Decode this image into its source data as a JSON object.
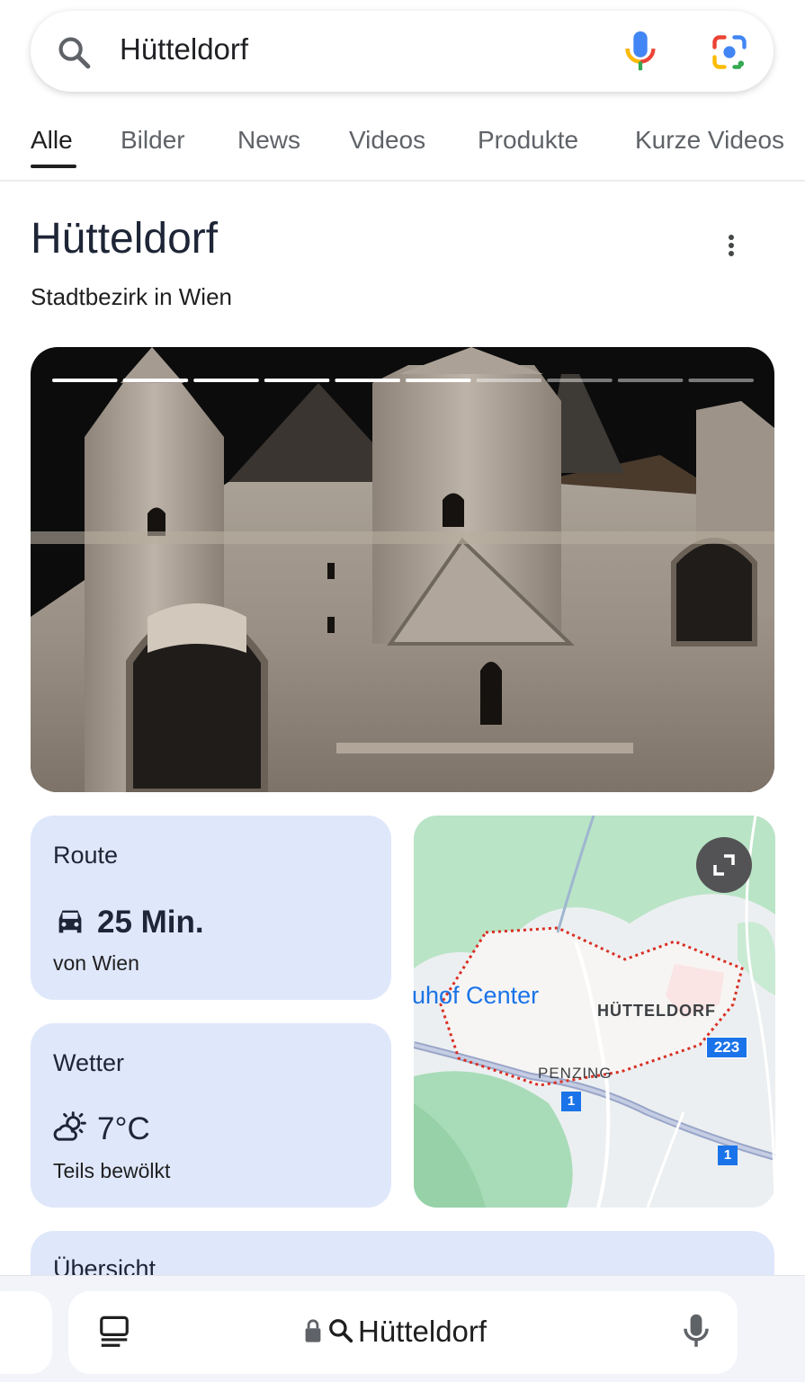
{
  "search": {
    "query": "Hütteldorf"
  },
  "tabs": [
    "Alle",
    "Bilder",
    "News",
    "Videos",
    "Produkte",
    "Kurze Videos"
  ],
  "knowledge": {
    "title": "Hütteldorf",
    "subtitle": "Stadtbezirk in Wien"
  },
  "gallery": {
    "segments_total": 10,
    "segments_watched": 6
  },
  "route": {
    "title": "Route",
    "duration": "25 Min.",
    "origin": "von Wien"
  },
  "weather": {
    "title": "Wetter",
    "temp": "7°C",
    "condition": "Teils bewölkt"
  },
  "map": {
    "label_center": "uhof Center",
    "label_district": "HÜTTELDORF",
    "label_penzing": "PENZING",
    "shield_223": "223",
    "shield_1a": "1",
    "shield_1b": "1"
  },
  "overview": {
    "title": "Übersicht"
  },
  "bottom_bar": {
    "address": "Hütteldorf"
  },
  "colors": {
    "accent": "#1a73e8",
    "card_bg": "#dfe7fa",
    "text_dark": "#1d2536"
  }
}
